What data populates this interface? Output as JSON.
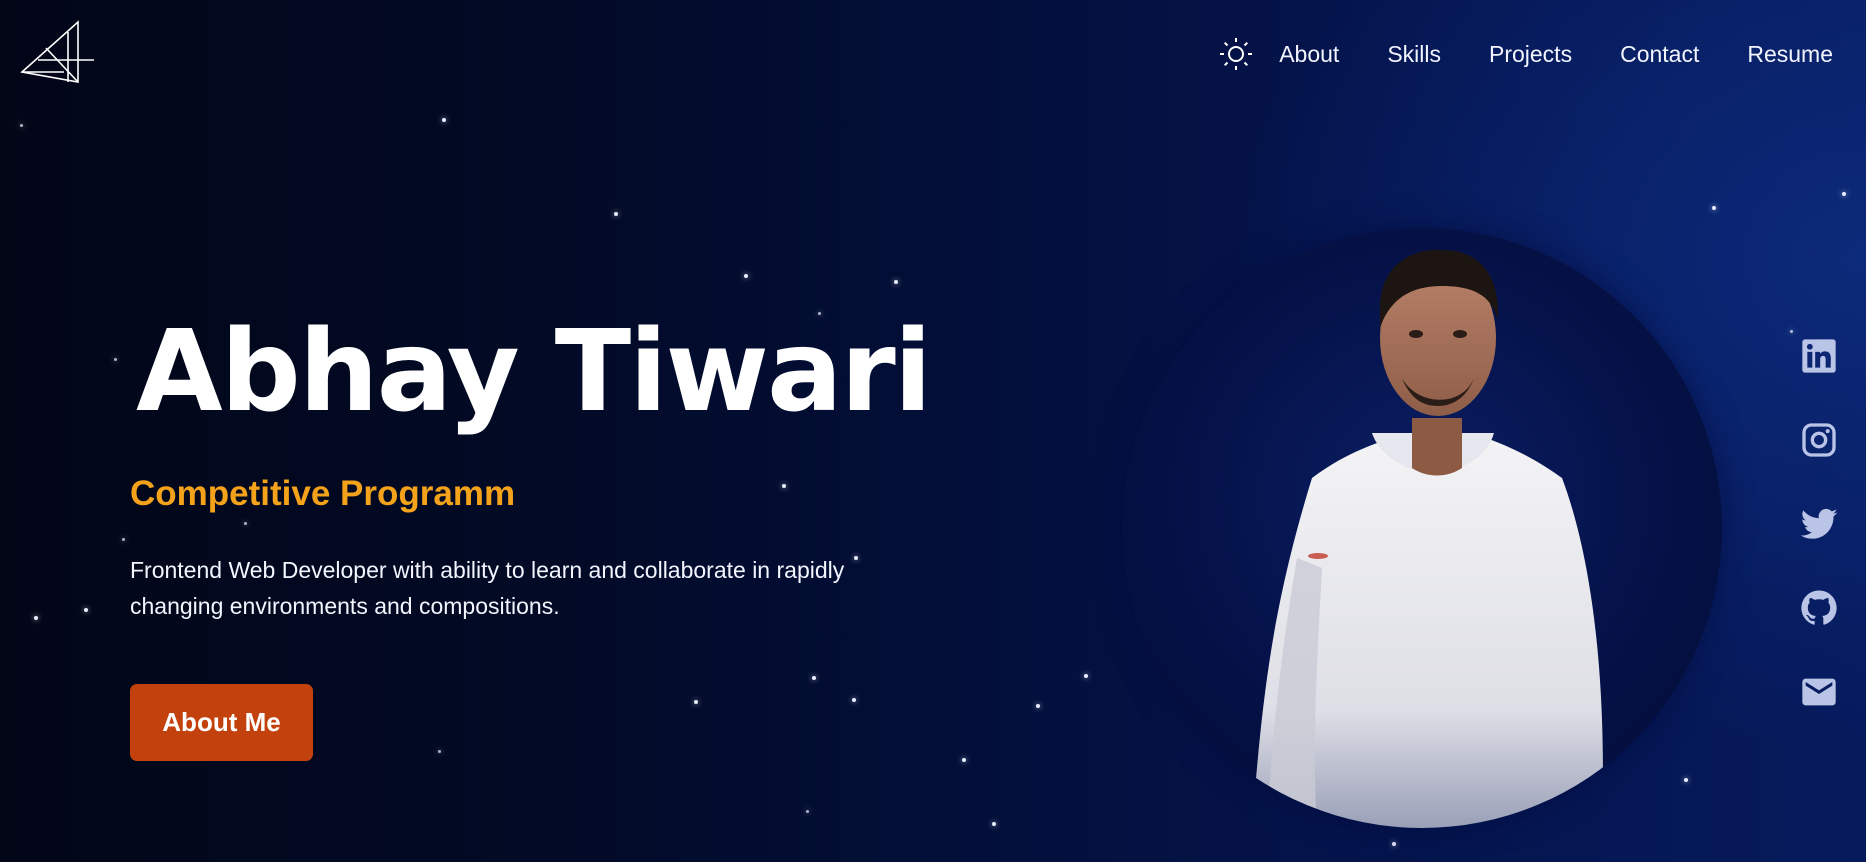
{
  "logo": {
    "icon": "monogram-logo-icon"
  },
  "nav": {
    "theme_icon": "sun-icon",
    "links": [
      "About",
      "Skills",
      "Projects",
      "Contact",
      "Resume"
    ]
  },
  "hero": {
    "name": "Abhay Tiwari",
    "role": "Competitive Programm",
    "description": "Frontend Web Developer with ability to learn and collaborate in rapidly changing environments and compositions.",
    "button_label": "About Me"
  },
  "portrait": {
    "alt": "Abhay Tiwari portrait"
  },
  "socials": [
    "linkedin-icon",
    "instagram-icon",
    "twitter-icon",
    "github-icon",
    "mail-icon"
  ],
  "colors": {
    "accent_orange": "#f5a21b",
    "button_orange": "#c2410c",
    "background_dark": "#020617",
    "background_blue": "#061a5c",
    "social_icon": "#b9c4e6"
  }
}
